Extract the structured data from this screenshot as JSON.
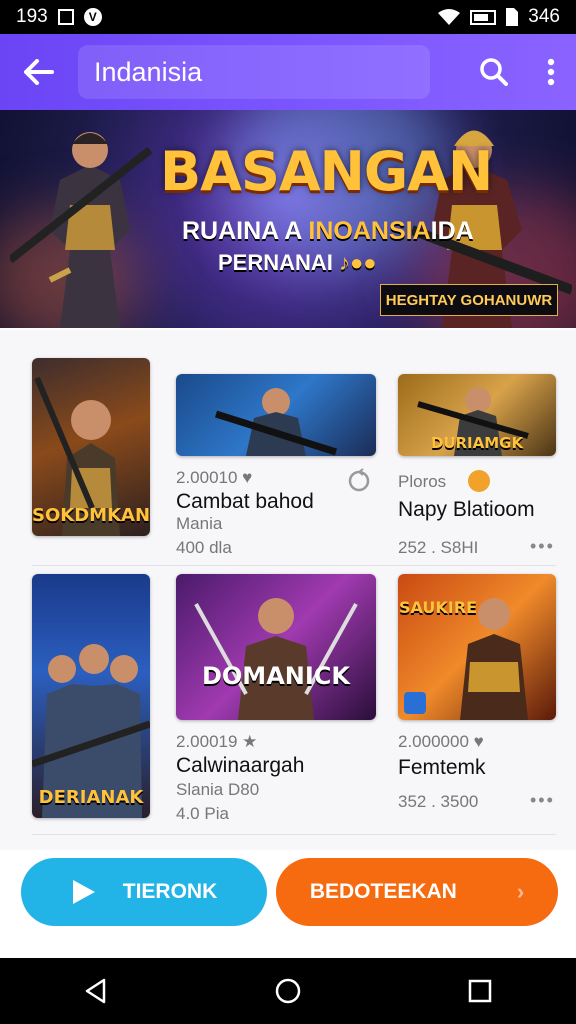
{
  "status_bar": {
    "time": "193",
    "icons": [
      "image-icon",
      "app-badge-icon",
      "wifi-icon",
      "battery-icon",
      "sim-icon"
    ],
    "battery_text": "346"
  },
  "app_bar": {
    "title": "Indanisia",
    "icons": [
      "back-arrow-icon",
      "search-icon",
      "more-vertical-icon"
    ]
  },
  "banner": {
    "title": "BASANGAN",
    "subtitle_white": "RUAINA A ",
    "subtitle_gold": "INOANSIA",
    "subtitle_end": "IDA",
    "line3_white": "PERNANAI ",
    "line3_gold": "♪●●",
    "badge": "HEGHTAY GOHANUWR"
  },
  "cards": [
    {
      "thumb_title": "SOKDMKAN",
      "meta": "",
      "name": "",
      "sub": "",
      "extra": ""
    },
    {
      "thumb_title": "",
      "meta": "2.00010 ♥",
      "name": "Cambat bahod",
      "sub": "Mania",
      "extra": "400 dla"
    },
    {
      "thumb_title": "DURIAMGK",
      "meta": "Ploros",
      "name": "Napy Blatioom",
      "sub": "",
      "extra": "252 . S8HI"
    },
    {
      "thumb_title": "DERIANAK",
      "meta": "",
      "name": "",
      "sub": "",
      "extra": ""
    },
    {
      "thumb_title": "DOMANICK",
      "meta": "2.00019 ★",
      "name": "Calwinaargah",
      "sub": "Slania D80",
      "extra": "4.0 Pia"
    },
    {
      "thumb_title": "SAUKIRE",
      "meta": "2.000000 ♥",
      "name": "Femtemk",
      "sub": "",
      "extra": "352 . 3500"
    }
  ],
  "buttons": {
    "left_label": "TIERONK",
    "right_label": "BEDOTEEKAN"
  },
  "colors": {
    "app_bar": "#6b45f5",
    "left_button": "#22b4e6",
    "right_button": "#f66a10",
    "title_gold": "#ffc23a"
  }
}
